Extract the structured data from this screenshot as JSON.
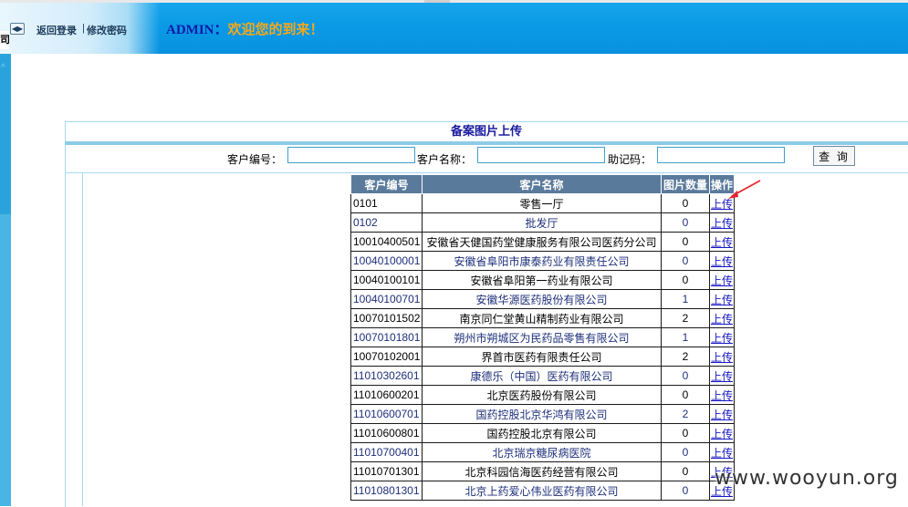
{
  "header": {
    "back_login": "返回登录",
    "separator": "|",
    "change_password": "修改密码",
    "admin_label": "ADMIN：",
    "welcome": "欢迎您的到来！"
  },
  "sidebar": {
    "tab_char": "司"
  },
  "page": {
    "title": "备案图片上传"
  },
  "search": {
    "customer_code_label": "客户编号：",
    "customer_code_value": "",
    "customer_name_label": "客户名称：",
    "customer_name_value": "",
    "mnemonic_label": "助记码：",
    "mnemonic_value": "",
    "query_button": "查 询"
  },
  "table": {
    "headers": [
      "客户编号",
      "客户名称",
      "图片数量",
      "操作"
    ],
    "rows": [
      {
        "code": "0101",
        "name": "零售一厅",
        "count": "0",
        "action": "上传"
      },
      {
        "code": "0102",
        "name": "批发厅",
        "count": "0",
        "action": "上传"
      },
      {
        "code": "10010400501",
        "name": "安徽省天健国药堂健康服务有限公司医药分公司",
        "count": "0",
        "action": "上传"
      },
      {
        "code": "10040100001",
        "name": "安徽省阜阳市康泰药业有限责任公司",
        "count": "0",
        "action": "上传"
      },
      {
        "code": "10040100101",
        "name": "安徽省阜阳第一药业有限公司",
        "count": "0",
        "action": "上传"
      },
      {
        "code": "10040100701",
        "name": "安徽华源医药股份有限公司",
        "count": "1",
        "action": "上传"
      },
      {
        "code": "10070101502",
        "name": "南京同仁堂黄山精制药业有限公司",
        "count": "2",
        "action": "上传"
      },
      {
        "code": "10070101801",
        "name": "朔州市朔城区为民药品零售有限公司",
        "count": "1",
        "action": "上传"
      },
      {
        "code": "10070102001",
        "name": "界首市医药有限责任公司",
        "count": "2",
        "action": "上传"
      },
      {
        "code": "11010302601",
        "name": "康德乐（中国）医药有限公司",
        "count": "0",
        "action": "上传"
      },
      {
        "code": "11010600201",
        "name": "北京医药股份有限公司",
        "count": "0",
        "action": "上传"
      },
      {
        "code": "11010600701",
        "name": "国药控股北京华鸿有限公司",
        "count": "2",
        "action": "上传"
      },
      {
        "code": "11010600801",
        "name": "国药控股北京有限公司",
        "count": "0",
        "action": "上传"
      },
      {
        "code": "11010700401",
        "name": "北京瑞京糖尿病医院",
        "count": "0",
        "action": "上传"
      },
      {
        "code": "11010701301",
        "name": "北京科园信海医药经营有限公司",
        "count": "0",
        "action": "上传"
      },
      {
        "code": "11010801301",
        "name": "北京上药爱心伟业医药有限公司",
        "count": "0",
        "action": "上传"
      }
    ]
  },
  "watermark": "www.wooyun.org",
  "colors": {
    "header_blue": "#0b9be6",
    "table_header": "#5a7a9c",
    "link_blue": "#1717c2",
    "title_blue": "#1b1b9f",
    "welcome_orange": "#f5a81c",
    "annotation_red": "#e8232f"
  }
}
